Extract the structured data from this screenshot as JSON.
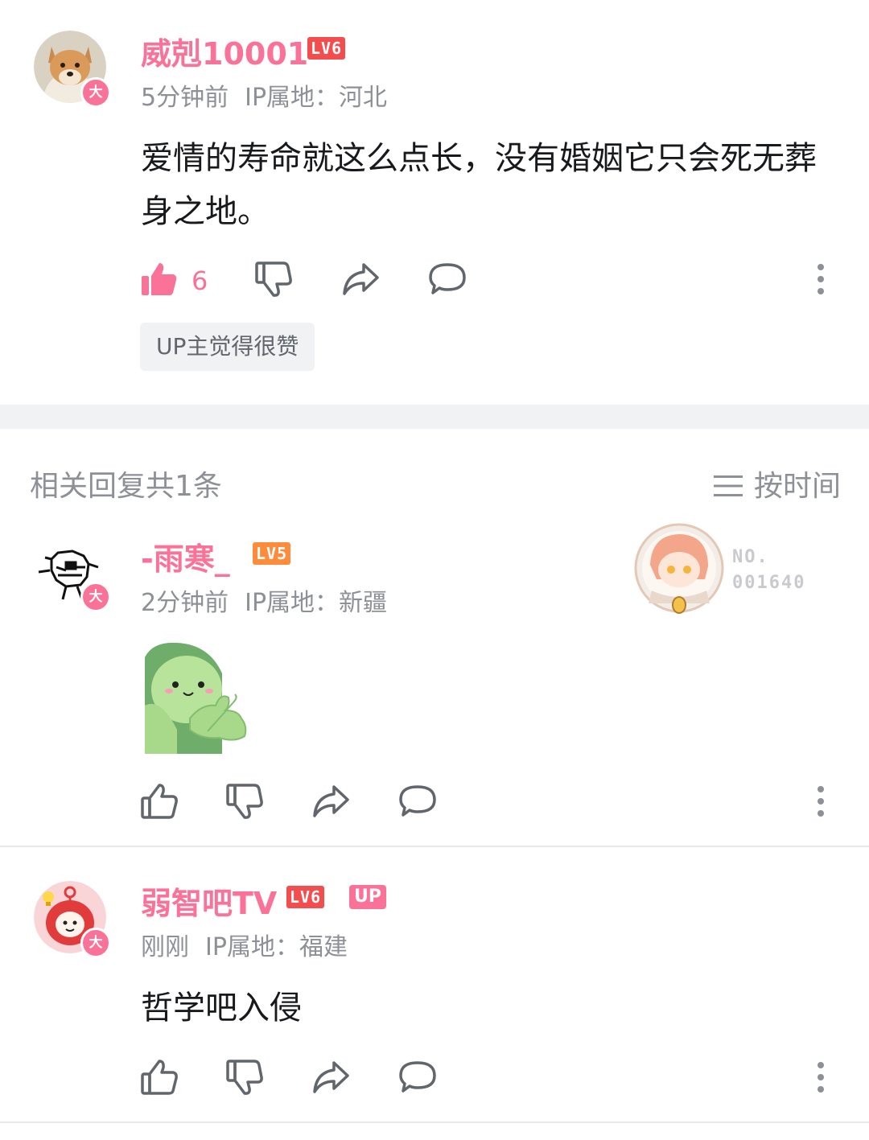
{
  "comments": [
    {
      "username": "威剋10001",
      "level": "LV6",
      "level_color": "#f34d4d",
      "vip_badge": "大",
      "time": "5分钟前",
      "ip": "IP属地：河北",
      "text": "爱情的寿命就这么点长，没有婚姻它只会死无葬身之地。",
      "like_count": "6",
      "liked": true,
      "up_chip": "UP主觉得很赞",
      "avatar_icon": "shiba-dog-avatar"
    }
  ],
  "replies_section": {
    "title": "相关回复共1条",
    "sort_label": "按时间",
    "sort_icon": "list-icon"
  },
  "replies": [
    {
      "username": "-雨寒_",
      "level": "LV5",
      "level_color": "#ff8c3a",
      "vip_badge": "大",
      "time": "2分钟前",
      "ip": "IP属地：新疆",
      "sticker": "green-turtle-thumbs-up-sticker",
      "fan_card_no": "NO.",
      "fan_card_num": "001640",
      "avatar_icon": "pixel-sketch-avatar"
    },
    {
      "username": "弱智吧TV",
      "level": "LV6",
      "level_color": "#f34d4d",
      "up_tag": "UP",
      "vip_badge": "大",
      "time": "刚刚",
      "ip": "IP属地：福建",
      "text": "哲学吧入侵",
      "avatar_icon": "red-doll-avatar"
    }
  ],
  "colors": {
    "accent": "#fb7299",
    "meta": "#8d9096",
    "icon": "#61666d",
    "band": "#f1f2f3"
  }
}
